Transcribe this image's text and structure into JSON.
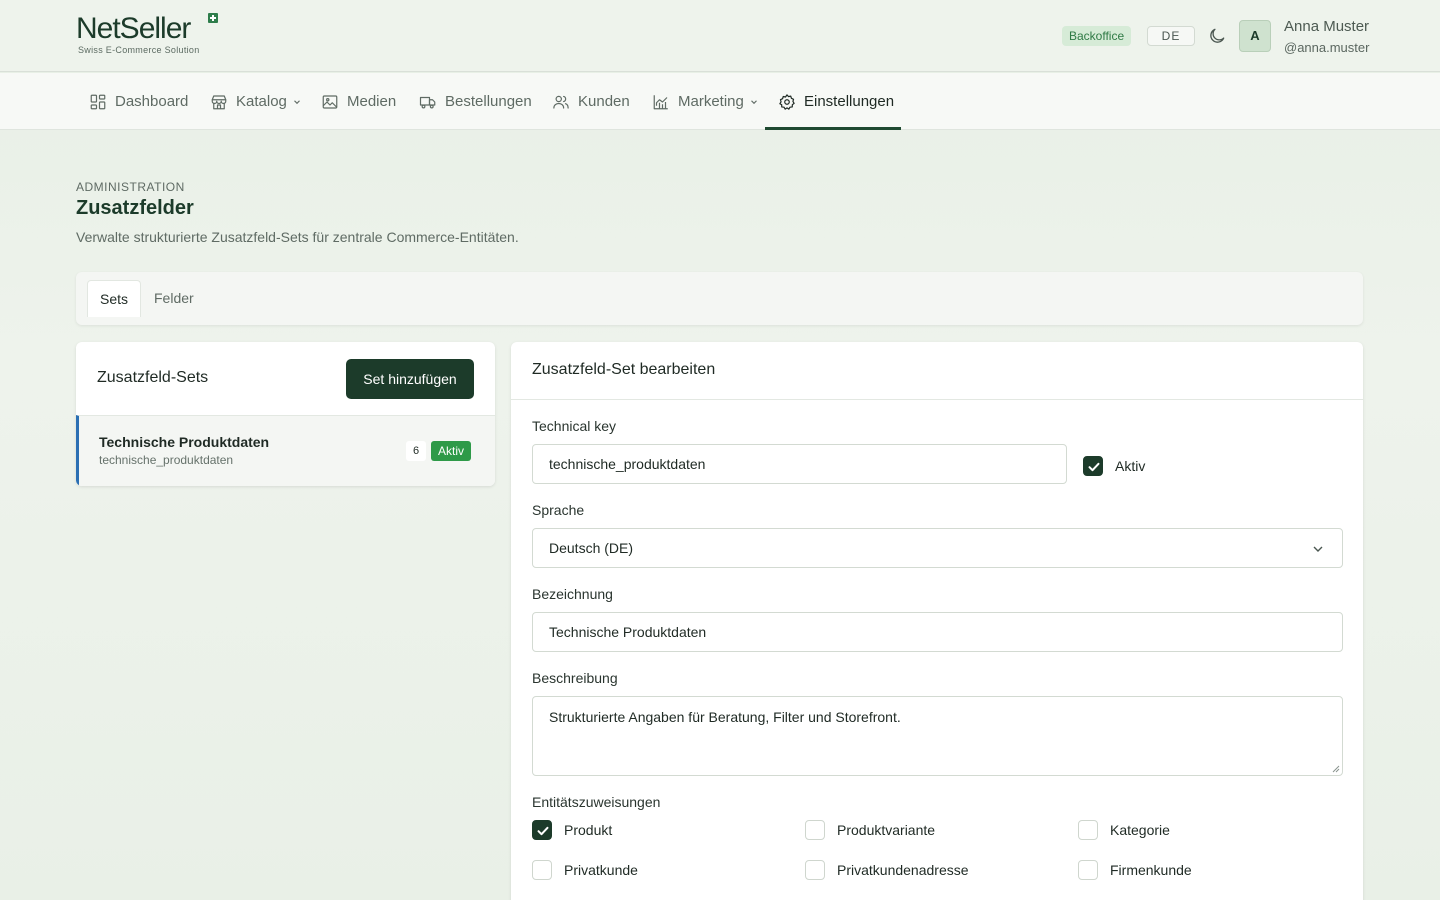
{
  "header": {
    "logo_text": "NetSeller",
    "logo_sub": "Swiss E-Commerce Solution",
    "badge": "Backoffice",
    "language": "DE",
    "avatar_initial": "A",
    "user_name": "Anna Muster",
    "user_handle": "@anna.muster"
  },
  "nav": {
    "items": [
      {
        "label": "Dashboard",
        "icon": "dashboard-icon"
      },
      {
        "label": "Katalog",
        "icon": "store-icon",
        "dropdown": true
      },
      {
        "label": "Medien",
        "icon": "image-icon"
      },
      {
        "label": "Bestellungen",
        "icon": "truck-icon"
      },
      {
        "label": "Kunden",
        "icon": "users-icon"
      },
      {
        "label": "Marketing",
        "icon": "chart-icon",
        "dropdown": true
      },
      {
        "label": "Einstellungen",
        "icon": "gear-icon",
        "active": true
      }
    ]
  },
  "page": {
    "eyebrow": "ADMINISTRATION",
    "title": "Zusatzfelder",
    "description": "Verwalte strukturierte Zusatzfeld-Sets für zentrale Commerce-Entitäten."
  },
  "tabs": [
    "Sets",
    "Felder"
  ],
  "sets_panel": {
    "title": "Zusatzfeld-Sets",
    "add_button": "Set hinzufügen",
    "items": [
      {
        "name": "Technische Produktdaten",
        "key": "technische_produktdaten",
        "count": "6",
        "status": "Aktiv"
      }
    ]
  },
  "editor": {
    "title": "Zusatzfeld-Set bearbeiten",
    "technical_key_label": "Technical key",
    "technical_key_value": "technische_produktdaten",
    "active_label": "Aktiv",
    "active_checked": true,
    "language_label": "Sprache",
    "language_value": "Deutsch (DE)",
    "name_label": "Bezeichnung",
    "name_value": "Technische Produktdaten",
    "description_label": "Beschreibung",
    "description_value": "Strukturierte Angaben für Beratung, Filter und Storefront.",
    "assignments_label": "Entitätszuweisungen",
    "assignments": [
      {
        "label": "Produkt",
        "checked": true
      },
      {
        "label": "Produktvariante",
        "checked": false
      },
      {
        "label": "Kategorie",
        "checked": false
      },
      {
        "label": "Privatkunde",
        "checked": false
      },
      {
        "label": "Privatkundenadresse",
        "checked": false
      },
      {
        "label": "Firmenkunde",
        "checked": false
      }
    ]
  },
  "colors": {
    "brand_dark": "#1c3b2a",
    "success": "#2e9a48",
    "selected_border": "#2b6fb3"
  }
}
